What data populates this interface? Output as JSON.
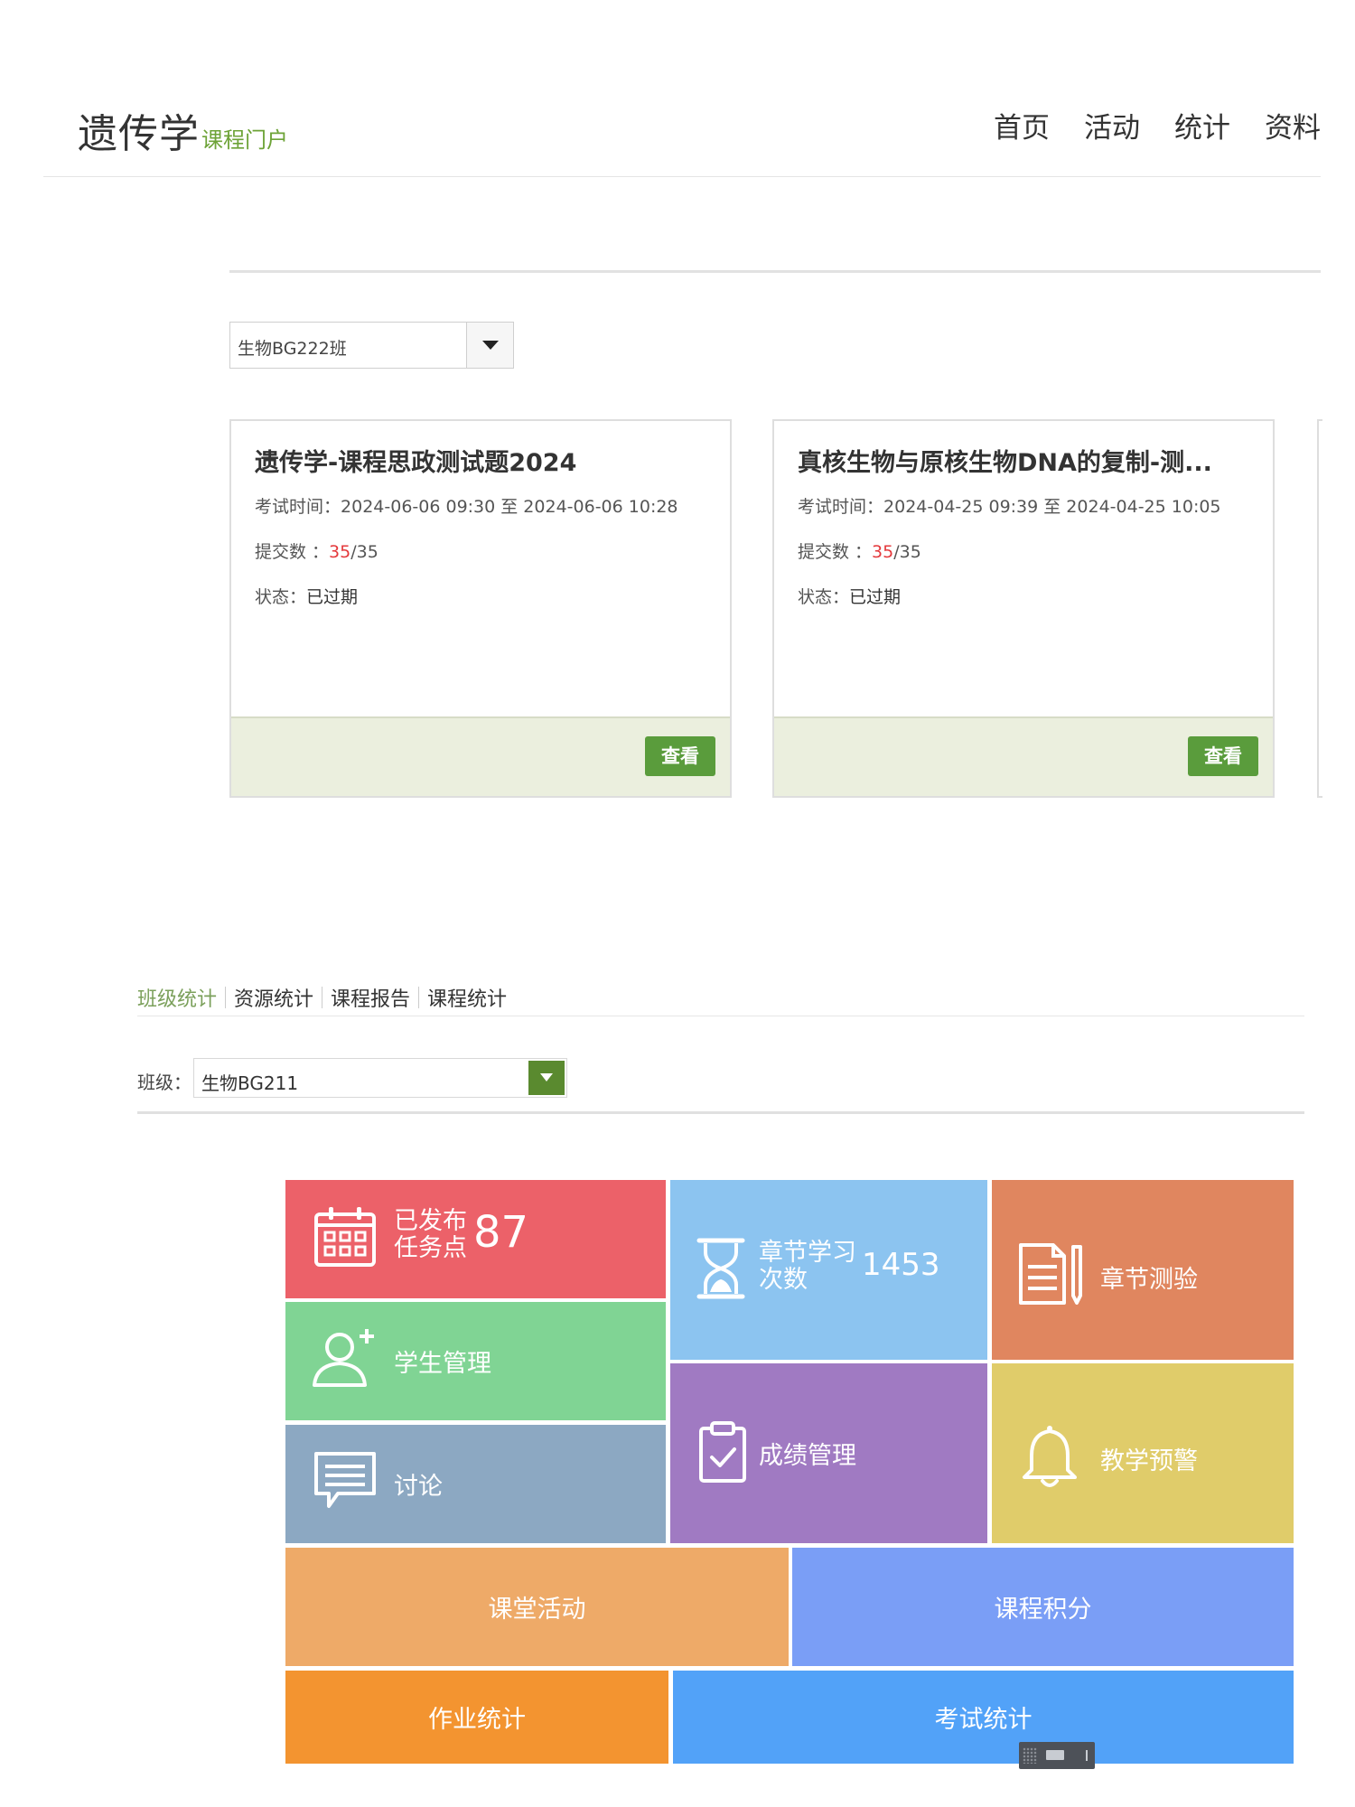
{
  "header": {
    "logo_main": "遗传学",
    "logo_sub": "课程门户",
    "nav": [
      "首页",
      "活动",
      "统计",
      "资料"
    ]
  },
  "exam_section": {
    "class_select": "生物BG222班",
    "cards": [
      {
        "title": "遗传学-课程思政测试题2024",
        "time_label": "考试时间：",
        "time": "2024-06-06 09:30 至 2024-06-06 10:28",
        "submit_label": "提交数 ：",
        "submit_count": "35",
        "submit_total": "/35",
        "status_label": "状态：",
        "status": "已过期",
        "button": "查看"
      },
      {
        "title": "真核生物与原核生物DNA的复制-测...",
        "time_label": "考试时间：",
        "time": "2024-04-25 09:39 至 2024-04-25 10:05",
        "submit_label": "提交数 ：",
        "submit_count": "35",
        "submit_total": "/35",
        "status_label": "状态：",
        "status": "已过期",
        "button": "查看"
      }
    ]
  },
  "stats": {
    "tabs": [
      "班级统计",
      "资源统计",
      "课程报告",
      "课程统计"
    ],
    "active_tab": 0,
    "class_label": "班级：",
    "class_select": "生物BG211",
    "tiles": {
      "published": {
        "label_line1": "已发布",
        "label_line2": "任务点",
        "value": "87",
        "color": "#ec6169"
      },
      "chapter_study": {
        "label_line1": "章节学习",
        "label_line2": "次数",
        "value": "1453",
        "color": "#8cc4f0"
      },
      "chapter_test": {
        "label": "章节测验",
        "color": "#e0865f"
      },
      "student_mgmt": {
        "label": "学生管理",
        "color": "#80d494"
      },
      "discussion": {
        "label": "讨论",
        "color": "#8ca8c2"
      },
      "grade_mgmt": {
        "label": "成绩管理",
        "color": "#a07ac2"
      },
      "teaching_alert": {
        "label": "教学预警",
        "color": "#e0cc6a"
      },
      "class_activity": {
        "label": "课堂活动",
        "color": "#eeaa68"
      },
      "course_points": {
        "label": "课程积分",
        "color": "#7a9ef6"
      },
      "homework_stats": {
        "label": "作业统计",
        "color": "#f39430"
      },
      "exam_stats": {
        "label": "考试统计",
        "color": "#52a2f8"
      }
    }
  }
}
